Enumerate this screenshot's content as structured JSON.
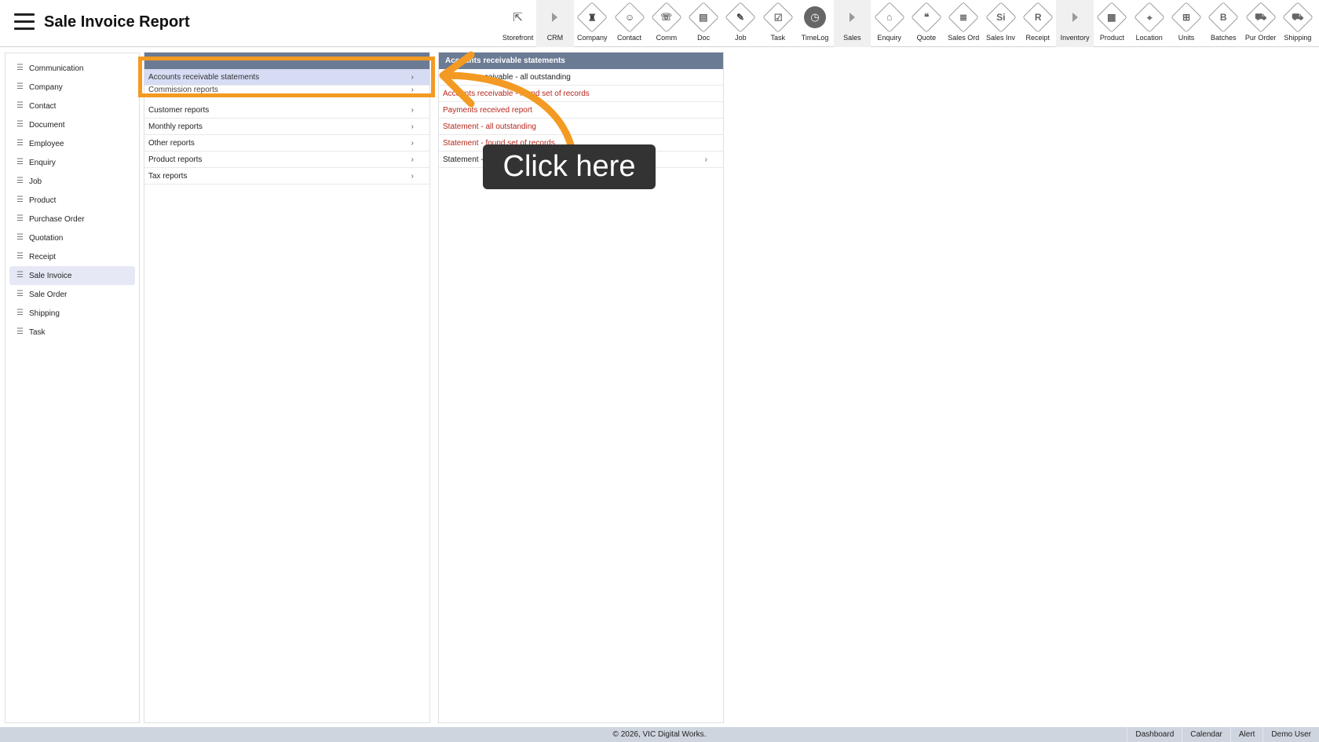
{
  "header": {
    "title": "Sale Invoice Report"
  },
  "toolbar": {
    "items": [
      {
        "label": "Storefront",
        "icon": "external-link-icon",
        "glyph": "⇱"
      },
      {
        "label": "CRM",
        "icon": "section-arrow-icon",
        "glyph": ""
      },
      {
        "label": "Company",
        "icon": "company-icon",
        "glyph": "♜"
      },
      {
        "label": "Contact",
        "icon": "contact-icon",
        "glyph": "☺"
      },
      {
        "label": "Comm",
        "icon": "comm-icon",
        "glyph": "☏"
      },
      {
        "label": "Doc",
        "icon": "doc-icon",
        "glyph": "▤"
      },
      {
        "label": "Job",
        "icon": "job-icon",
        "glyph": "✎"
      },
      {
        "label": "Task",
        "icon": "task-icon",
        "glyph": "☑"
      },
      {
        "label": "TimeLog",
        "icon": "clock-icon",
        "glyph": "◷"
      },
      {
        "label": "Sales",
        "icon": "section-arrow-icon",
        "glyph": ""
      },
      {
        "label": "Enquiry",
        "icon": "enquiry-icon",
        "glyph": "⌂"
      },
      {
        "label": "Quote",
        "icon": "quote-icon",
        "glyph": "❝"
      },
      {
        "label": "Sales Ord",
        "icon": "sales-order-icon",
        "glyph": "≣"
      },
      {
        "label": "Sales Inv",
        "icon": "sales-invoice-icon",
        "glyph": "Si"
      },
      {
        "label": "Receipt",
        "icon": "receipt-icon",
        "glyph": "R"
      },
      {
        "label": "Inventory",
        "icon": "section-arrow-icon",
        "glyph": ""
      },
      {
        "label": "Product",
        "icon": "product-icon",
        "glyph": "▦"
      },
      {
        "label": "Location",
        "icon": "location-icon",
        "glyph": "⌖"
      },
      {
        "label": "Units",
        "icon": "units-icon",
        "glyph": "⊞"
      },
      {
        "label": "Batches",
        "icon": "batches-icon",
        "glyph": "B"
      },
      {
        "label": "Pur Order",
        "icon": "cart-icon",
        "glyph": "⛟"
      },
      {
        "label": "Shipping",
        "icon": "truck-icon",
        "glyph": "⛟"
      }
    ]
  },
  "sidebar": {
    "items": [
      {
        "label": "Communication"
      },
      {
        "label": "Company"
      },
      {
        "label": "Contact"
      },
      {
        "label": "Document"
      },
      {
        "label": "Employee"
      },
      {
        "label": "Enquiry"
      },
      {
        "label": "Job"
      },
      {
        "label": "Product"
      },
      {
        "label": "Purchase Order"
      },
      {
        "label": "Quotation"
      },
      {
        "label": "Receipt"
      },
      {
        "label": "Sale Invoice"
      },
      {
        "label": "Sale Order"
      },
      {
        "label": "Shipping"
      },
      {
        "label": "Task"
      }
    ]
  },
  "categories": {
    "rows": [
      {
        "label": "Accounts receivable statements"
      },
      {
        "label": "Commission reports"
      },
      {
        "label": "Customer reports"
      },
      {
        "label": "Monthly reports"
      },
      {
        "label": "Other reports"
      },
      {
        "label": "Product reports"
      },
      {
        "label": "Tax reports"
      }
    ],
    "chevron": "›"
  },
  "subpanel": {
    "title": "Accounts receivable statements",
    "rows": [
      {
        "label": "Accounts receivable - all outstanding"
      },
      {
        "label": "Accounts receivable - found set of records"
      },
      {
        "label": "Payments received report"
      },
      {
        "label": "Statement - all outstanding"
      },
      {
        "label": "Statement - found set of records"
      },
      {
        "label": "Statement - outstanding"
      }
    ],
    "chevron": "›"
  },
  "annotation": {
    "tooltip": "Click here",
    "accent": "#f39a23"
  },
  "footer": {
    "copyright": "© 2026, VIC Digital Works.",
    "links": [
      {
        "label": "Dashboard"
      },
      {
        "label": "Calendar"
      },
      {
        "label": "Alert"
      },
      {
        "label": "Demo User"
      }
    ]
  }
}
